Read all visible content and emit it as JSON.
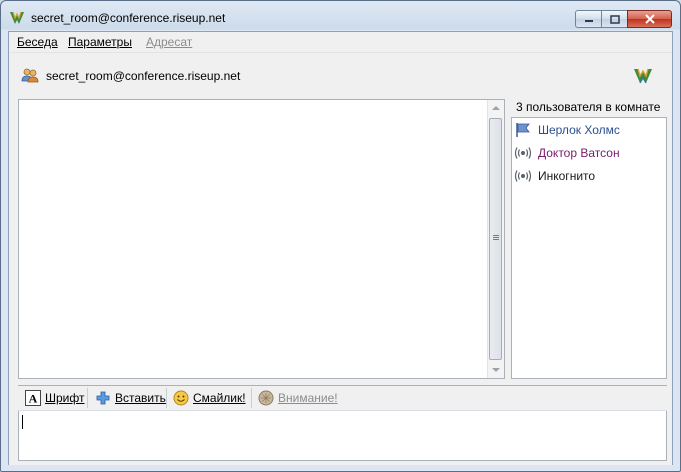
{
  "window": {
    "title": "secret_room@conference.riseup.net",
    "controls": {
      "minimize": "minimize-icon",
      "maximize": "maximize-icon",
      "close": "close-icon"
    }
  },
  "menubar": {
    "items": [
      {
        "label": "Беседа",
        "enabled": true
      },
      {
        "label": "Параметры",
        "enabled": true
      },
      {
        "label": "Адресат",
        "enabled": false
      }
    ]
  },
  "header": {
    "room_icon": "group-users-icon",
    "room_title": "secret_room@conference.riseup.net",
    "logo": "app-logo-icon"
  },
  "chat": {
    "messages": []
  },
  "users": {
    "header": "3 пользователя в комнате",
    "list": [
      {
        "name": "Шерлок Холмс",
        "icon": "flag-icon",
        "color": "#2b4f8f"
      },
      {
        "name": "Доктор Ватсон",
        "icon": "signal-icon",
        "color": "#7a1b6b"
      },
      {
        "name": "Инкогнито",
        "icon": "signal-icon",
        "color": "#1a1a1a"
      }
    ]
  },
  "toolbar": {
    "font_label": "Шрифт",
    "insert_label": "Вставить",
    "smiley_label": "Смайлик!",
    "attention_label": "Внимание!"
  },
  "input": {
    "value": ""
  },
  "colors": {
    "accent_blue": "#2b4f8f",
    "accent_purple": "#7a1b6b",
    "close_red": "#c1321a"
  }
}
